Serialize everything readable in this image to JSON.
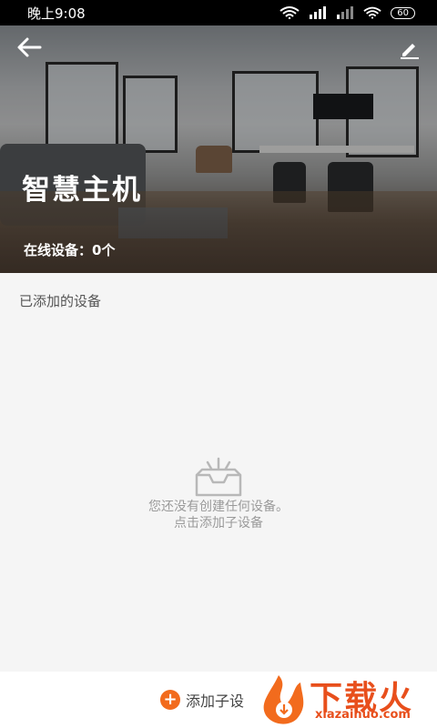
{
  "status_bar": {
    "time": "晚上9:08",
    "battery": "60"
  },
  "header": {
    "title": "智慧主机",
    "online_devices": "在线设备：0个"
  },
  "section": {
    "label": "已添加的设备"
  },
  "empty_state": {
    "line1": "您还没有创建任何设备。",
    "line2": "点击添加子设备"
  },
  "bottom": {
    "add_label": "添加子设"
  },
  "watermark": {
    "text": "下载火",
    "sub": "xiazaihuo.com"
  },
  "colors": {
    "accent": "#f26b1d",
    "status_bg": "#000000",
    "page_bg": "#f5f5f5"
  },
  "icons": {
    "back": "arrow-left-icon",
    "edit": "pencil-icon",
    "empty": "inbox-tray-icon",
    "add": "plus-circle-icon"
  }
}
